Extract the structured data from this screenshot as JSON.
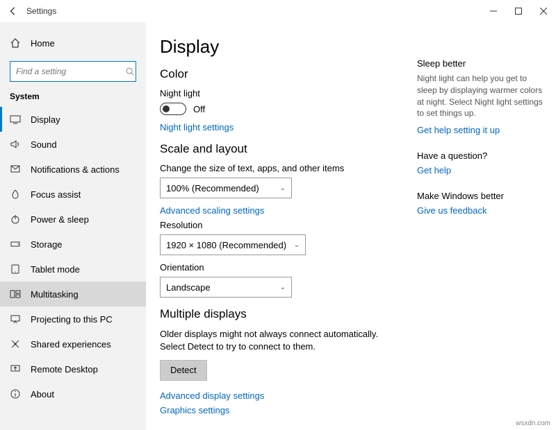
{
  "titlebar": {
    "title": "Settings"
  },
  "sidebar": {
    "home": "Home",
    "search_placeholder": "Find a setting",
    "section": "System",
    "items": [
      {
        "label": "Display"
      },
      {
        "label": "Sound"
      },
      {
        "label": "Notifications & actions"
      },
      {
        "label": "Focus assist"
      },
      {
        "label": "Power & sleep"
      },
      {
        "label": "Storage"
      },
      {
        "label": "Tablet mode"
      },
      {
        "label": "Multitasking"
      },
      {
        "label": "Projecting to this PC"
      },
      {
        "label": "Shared experiences"
      },
      {
        "label": "Remote Desktop"
      },
      {
        "label": "About"
      }
    ]
  },
  "main": {
    "title": "Display",
    "color": {
      "heading": "Color",
      "night_light_label": "Night light",
      "night_light_state": "Off",
      "night_light_settings": "Night light settings"
    },
    "scale": {
      "heading": "Scale and layout",
      "change_size_label": "Change the size of text, apps, and other items",
      "size_value": "100% (Recommended)",
      "advanced_scaling": "Advanced scaling settings",
      "resolution_label": "Resolution",
      "resolution_value": "1920 × 1080 (Recommended)",
      "orientation_label": "Orientation",
      "orientation_value": "Landscape"
    },
    "multi": {
      "heading": "Multiple displays",
      "text": "Older displays might not always connect automatically. Select Detect to try to connect to them.",
      "detect": "Detect",
      "advanced_display": "Advanced display settings",
      "graphics": "Graphics settings"
    }
  },
  "aside": {
    "sleep": {
      "heading": "Sleep better",
      "text": "Night light can help you get to sleep by displaying warmer colors at night. Select Night light settings to set things up.",
      "link": "Get help setting it up"
    },
    "question": {
      "heading": "Have a question?",
      "link": "Get help"
    },
    "better": {
      "heading": "Make Windows better",
      "link": "Give us feedback"
    }
  },
  "watermark": "wsxdn.com"
}
